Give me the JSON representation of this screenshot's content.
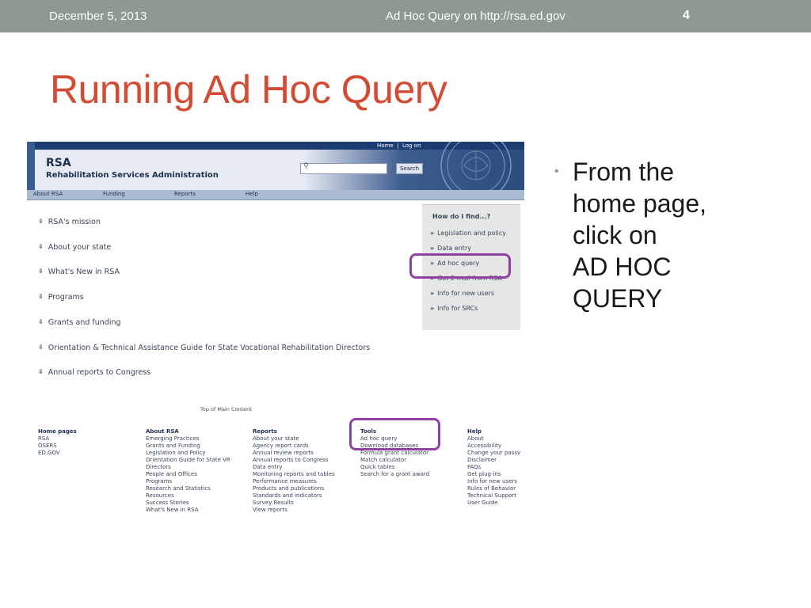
{
  "slide": {
    "date": "December 5, 2013",
    "footer_title": "Ad Hoc Query on http://rsa.ed.gov",
    "page_number": "4",
    "title": "Running Ad Hoc Query",
    "bullet_lines": [
      "From the",
      "home page,",
      "click on",
      "AD HOC",
      "QUERY"
    ]
  },
  "site": {
    "top_links": [
      "Home",
      "|",
      "Log on"
    ],
    "acronym": "RSA",
    "full_name": "Rehabilitation Services Administration",
    "search_button": "Search",
    "nav": [
      "About RSA",
      "Funding",
      "Reports",
      "Help"
    ],
    "main_items": [
      "RSA's mission",
      "About your state",
      "What's New in RSA",
      "Programs",
      "Grants and funding",
      "Orientation & Technical Assistance Guide for State Vocational Rehabilitation Directors",
      "Annual reports to Congress"
    ],
    "how_do_i": {
      "heading": "How do I find...?",
      "items": [
        "Legislation and policy",
        "Data entry",
        "Ad hoc query",
        "Get E-mail from RSA",
        "Info for new users",
        "Info for SRCs"
      ]
    },
    "top_of_main": "Top of Main Content",
    "footer_columns": [
      {
        "heading": "Home pages",
        "links": [
          "RSA",
          "OSERS",
          "ED.GOV"
        ]
      },
      {
        "heading": "About RSA",
        "links": [
          "Emerging Practices",
          "Grants and Funding",
          "Legislation and Policy",
          "Orientation Guide for State VR",
          "Directors",
          "People and Offices",
          "Programs",
          "Research and Statistics",
          "Resources",
          "Success Stories",
          "What's New in RSA"
        ]
      },
      {
        "heading": "Reports",
        "links": [
          "About your state",
          "Agency report cards",
          "Annual review reports",
          "Annual reports to Congress",
          "Data entry",
          "Monitoring reports and tables",
          "Performance measures",
          "Products and publications",
          "Standards and indicators",
          "Survey Results",
          "View reports"
        ]
      },
      {
        "heading": "Tools",
        "links": [
          "Ad hoc query",
          "Download databases",
          "Formula grant calculator",
          "Match calculator",
          "Quick tables",
          "Search for a grant award"
        ]
      },
      {
        "heading": "Help",
        "links": [
          "About",
          "Accessibility",
          "Change your passv",
          "Disclaimer",
          "FAQs",
          "Get plug-ins",
          "Info for new users",
          "Rules of Behavior",
          "Technical Support",
          "User Guide"
        ]
      }
    ]
  },
  "icons": {
    "bullet_dot": "bullet-dot-icon",
    "main_chevron": "double-chevron-down-icon",
    "how_chevron": "double-chevron-right-icon",
    "search": "search-icon",
    "seal": "department-of-education-seal"
  },
  "colors": {
    "header_bar": "#8c9a8f",
    "title": "#d24b32",
    "highlight_circle": "#9240a3",
    "site_navy": "#1c3d72"
  }
}
